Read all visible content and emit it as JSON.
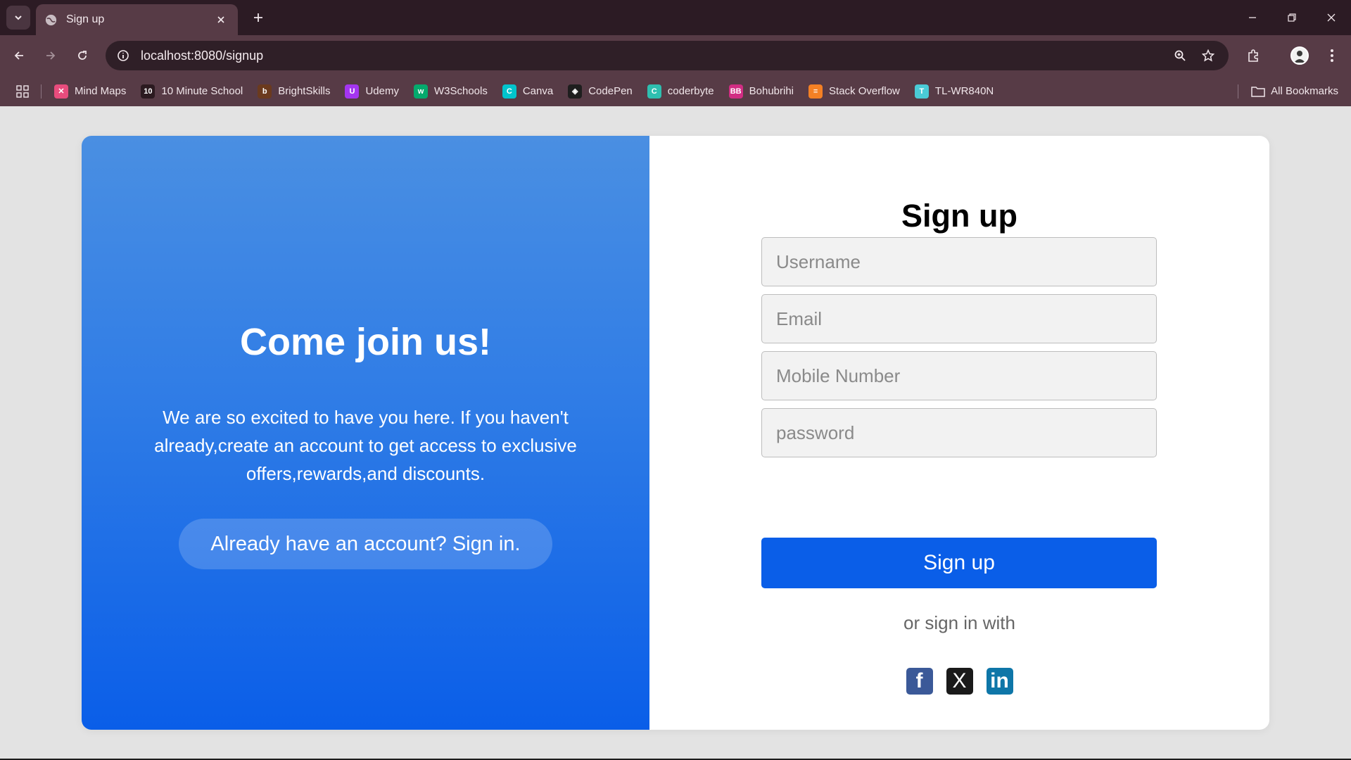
{
  "browser": {
    "tab": {
      "title": "Sign up"
    },
    "url": "localhost:8080/signup",
    "bookmarks": [
      {
        "label": "Mind Maps",
        "color": "#e84c7d",
        "glyph": "✕"
      },
      {
        "label": "10 Minute School",
        "color": "#2b1a20",
        "glyph": "10"
      },
      {
        "label": "BrightSkills",
        "color": "#6b3a1e",
        "glyph": "b"
      },
      {
        "label": "Udemy",
        "color": "#a435f0",
        "glyph": "U"
      },
      {
        "label": "W3Schools",
        "color": "#04aa6d",
        "glyph": "w"
      },
      {
        "label": "Canva",
        "color": "#00c4cc",
        "glyph": "C"
      },
      {
        "label": "CodePen",
        "color": "#1e1e1e",
        "glyph": "◈"
      },
      {
        "label": "coderbyte",
        "color": "#2ebfb0",
        "glyph": "C"
      },
      {
        "label": "Bohubrihi",
        "color": "#d12d83",
        "glyph": "BB"
      },
      {
        "label": "Stack Overflow",
        "color": "#f48024",
        "glyph": "≡"
      },
      {
        "label": "TL-WR840N",
        "color": "#4acbd6",
        "glyph": "T"
      }
    ],
    "all_bookmarks": "All Bookmarks"
  },
  "left": {
    "title": "Come join us!",
    "text": "We are so excited to have you here. If you haven't already,create an account to get access to exclusive offers,rewards,and discounts.",
    "signin_button": "Already have an account? Sign in."
  },
  "form": {
    "title": "Sign up",
    "username_placeholder": "Username",
    "email_placeholder": "Email",
    "mobile_placeholder": "Mobile Number",
    "password_placeholder": "password",
    "submit_label": "Sign up",
    "or_text": "or sign in with",
    "socials": {
      "facebook": "f",
      "x": "X",
      "linkedin": "in"
    }
  },
  "colors": {
    "accent": "#0a5ee8",
    "chrome_bg": "#573b46",
    "chrome_dark": "#2c1b24"
  }
}
